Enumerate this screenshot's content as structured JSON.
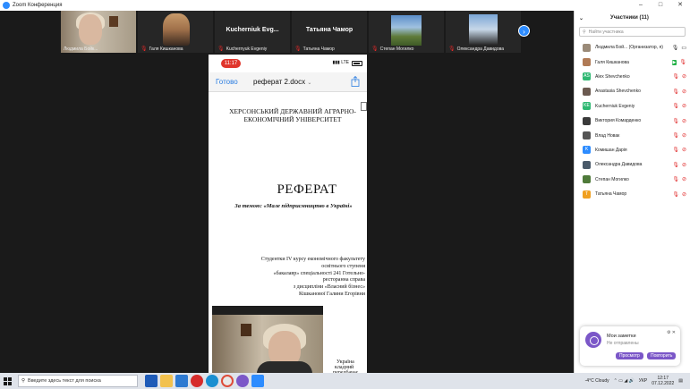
{
  "window": {
    "title": "Zoom Конференция"
  },
  "tiles": [
    {
      "name": "Людмила Бойк...",
      "type": "video-room",
      "active": true,
      "muted": false
    },
    {
      "name": "Галя Кишканова",
      "type": "video-girl",
      "active": false,
      "muted": true
    },
    {
      "name": "Kuchernyuk Evgeniy",
      "bigname": "Kucherniuk Evg...",
      "type": "name",
      "active": false,
      "muted": true
    },
    {
      "name": "Татьяна Чамор",
      "bigname": "Татьяна Чамор",
      "type": "name",
      "active": false,
      "muted": true
    },
    {
      "name": "Степан Могилко",
      "type": "video-house",
      "active": false,
      "muted": true
    },
    {
      "name": "Олександра Давидова",
      "type": "video-person",
      "active": false,
      "muted": true
    }
  ],
  "share": {
    "status_time": "11:17",
    "network": "LTE",
    "done_label": "Готово",
    "doc_title": "реферат 2.docx",
    "university_line1": "ХЕРСОНСЬКИЙ ДЕРЖАВНИЙ АГРАРНО-",
    "university_line2": "ЕКОНОМІЧНИЙ УНІВЕРСИТЕТ",
    "heading": "РЕФЕРАТ",
    "topic": "За темою: «Мале підприємництво в Україні»",
    "author_lines": [
      "Студентки IV курсу економічного факультету",
      "освітнього ступеня",
      "«бакалавр» спеціальності 241 Готельно-",
      "ресторанна справа",
      "з дисципліни «Власний бізнес»",
      "Кішканової Галини Егорівни"
    ],
    "peek_lines": [
      "Україна",
      "кладний",
      "передбачає"
    ]
  },
  "panel": {
    "title": "Участники (11)",
    "search_placeholder": "Найти участника",
    "participants": [
      {
        "name": "Людмила Бой... (Организатор, я)",
        "avatar": "photo",
        "color": "#9a8a78",
        "initials": "",
        "cam": "mic-on",
        "video": "cam-video"
      },
      {
        "name": "Галя Кишканова",
        "avatar": "photo",
        "color": "#b07a55",
        "initials": "",
        "cam": "cam-on",
        "video": "mic-off"
      },
      {
        "name": "Alex Shevchenko",
        "avatar": "initial",
        "color": "#2eb872",
        "initials": "AS",
        "cam": "mic-off",
        "video": "cam-off"
      },
      {
        "name": "Anastasia Shevchenko",
        "avatar": "photo",
        "color": "#6b5a50",
        "initials": "",
        "cam": "mic-off",
        "video": "cam-off"
      },
      {
        "name": "Kucherniuk Evgeniy",
        "avatar": "initial",
        "color": "#2eb872",
        "initials": "KE",
        "cam": "mic-off",
        "video": "cam-off"
      },
      {
        "name": "Виктория Комарденко",
        "avatar": "photo",
        "color": "#3a3a3a",
        "initials": "",
        "cam": "mic-off",
        "video": "cam-off"
      },
      {
        "name": "Влад Новак",
        "avatar": "photo",
        "color": "#555555",
        "initials": "",
        "cam": "mic-off",
        "video": "cam-off"
      },
      {
        "name": "Комишан Дарія",
        "avatar": "initial",
        "color": "#2d8cff",
        "initials": "K",
        "cam": "mic-off",
        "video": "cam-off"
      },
      {
        "name": "Олександра Давидова",
        "avatar": "photo",
        "color": "#4a5a6a",
        "initials": "",
        "cam": "mic-off",
        "video": "cam-off"
      },
      {
        "name": "Степан Могилко",
        "avatar": "photo",
        "color": "#4f7a3a",
        "initials": "",
        "cam": "mic-off",
        "video": "cam-off"
      },
      {
        "name": "Татьяна Чамор",
        "avatar": "initial",
        "color": "#f0a020",
        "initials": "T",
        "cam": "mic-off",
        "video": "cam-off"
      }
    ]
  },
  "notification": {
    "title": "Мои заметки",
    "subtitle": "Не отправлены",
    "view_label": "Просмотр",
    "retry_label": "Повторить"
  },
  "taskbar": {
    "search_placeholder": "Введите здесь текст для поиска",
    "weather": "-4°C Cloudy",
    "lang": "УКР",
    "time": "12:17",
    "date": "07.12.2022"
  }
}
